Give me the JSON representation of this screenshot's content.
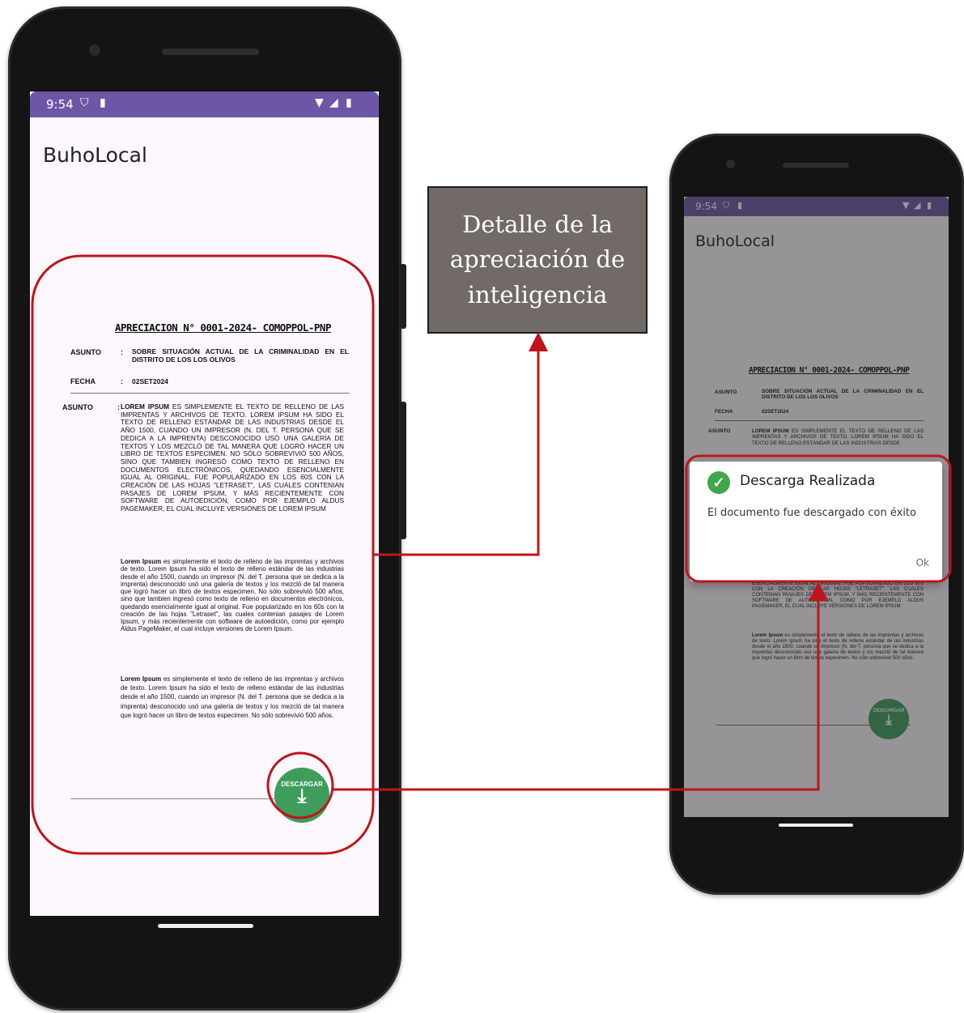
{
  "phone_left": {
    "status": {
      "time": "9:54",
      "left_icons": [
        "shield-icon",
        "sim-icon"
      ],
      "right_icons": [
        "wifi-icon",
        "signal-icon",
        "battery-icon"
      ]
    },
    "app_title": "BuhoLocal",
    "document": {
      "title": "APRECIACION N° 0001-2024- COMOPPOL-PNP",
      "asunto_label": "ASUNTO",
      "asunto_colon": ":",
      "asunto_value": "SOBRE SITUACIÓN ACTUAL DE LA CRIMINALIDAD EN EL DISTRITO DE LOS LOS OLIVOS",
      "fecha_label": "FECHA",
      "fecha_colon": ":",
      "fecha_value": "02SET2024",
      "body_label": "ASUNTO",
      "body_colon": ":",
      "body_lead": "LOREM IPSUM",
      "body_text": " ES SIMPLEMENTE EL TEXTO DE RELLENO DE LAS IMPRENTAS Y ARCHIVOS DE TEXTO. LOREM IPSUM HA SIDO EL TEXTO DE RELLENO ESTÁNDAR DE LAS INDUSTRIAS DESDE EL AÑO 1500, CUANDO UN IMPRESOR (N. DEL T. PERSONA QUE SE DEDICA A LA IMPRENTA) DESCONOCIDO USÓ UNA GALERÍA DE TEXTOS Y LOS MEZCLÓ DE TAL MANERA QUE LOGRÓ HACER UN LIBRO DE TEXTOS ESPECIMEN. NO SÓLO SOBREVIVIÓ 500 AÑOS, SINO QUE TAMBIEN INGRESÓ COMO TEXTO DE RELLENO EN DOCUMENTOS ELECTRÓNICOS, QUEDANDO ESENCIALMENTE IGUAL AL ORIGINAL. FUE POPULARIZADO EN LOS 60S CON LA CREACIÓN DE LAS HOJAS \"LETRASET\", LAS CUALES CONTENIAN PASAJES DE LOREM IPSUM, Y MÁS RECIENTEMENTE CON SOFTWARE DE AUTOEDICIÓN, COMO POR EJEMPLO ALDUS PAGEMAKER, EL CUAL INCLUYE VERSIONES DE LOREM IPSUM",
      "para2_lead": "Lorem Ipsum",
      "para2_text": " es simplemente el texto de relleno de las imprentas y archivos de texto. Lorem Ipsum ha sido el texto de relleno estándar de las industrias desde el año 1500, cuando un impresor (N. del T. persona que se dedica a la imprenta) desconocido usó una galería de textos y los mezcló de tal manera que logró hacer un libro de textos especimen. No sólo sobrevivió 500 años, sino que tambien ingresó como texto de relleno en documentos electrónicos, quedando esencialmente igual al original. Fue popularizado en los 60s con la creación de las hojas \"Letraset\", las cuales contenian pasajes de Lorem Ipsum, y más recientemente con software de autoedición, como por ejemplo Aldus PageMaker, el cual incluye versiones de Lorem Ipsum.",
      "para3_lead": "Lorem Ipsum",
      "para3_text": " es simplemente el texto de relleno de las imprentas y archivos de texto. Lorem Ipsum ha sido el texto de relleno estándar de las industrias desde el año 1500, cuando un impresor (N. del T. persona que se dedica a la imprenta) desconocido usó una galería de textos y los mezcló de tal manera que logró hacer un libro de textos especimen. No sólo sobrevivió 500 años."
    },
    "fab_label": "DESCARGAR",
    "fab_icon": "download-icon"
  },
  "annotation": {
    "text": "Detalle de la apreciación de inteligencia"
  },
  "phone_right": {
    "status": {
      "time": "9:54"
    },
    "app_title": "BuhoLocal",
    "document": {
      "title": "APRECIACION N° 0001-2024- COMOPPOL-PNP",
      "asunto_label": "ASUNTO",
      "asunto_value": "SOBRE SITUACIÓN ACTUAL DE LA CRIMINALIDAD EN EL DISTRITO DE LOS LOS OLIVOS",
      "fecha_label": "FECHA",
      "fecha_value": "02SET2024",
      "body_label": "ASUNTO",
      "body_lead": "LOREM IPSUM",
      "body_text": " ES SIMPLEMENTE EL TEXTO DE RELLENO DE LAS IMPRENTAS Y ARCHIVOS DE TEXTO. LOREM IPSUM HA SIDO EL TEXTO DE RELLENO ESTÁNDAR DE LAS INDUSTRIAS DESDE",
      "lower_text": "ESENCIALMENTE IGUAL AL ORIGINAL. FUE POPULARIZADO EN LOS 60S CON LA CREACIÓN DE LAS HOJAS \"LETRASET\", LAS CUALES CONTENIAN PASAJES DE LOREM IPSUM, Y MÁS RECIENTEMENTE CON SOFTWARE DE AUTOEDICIÓN, COMO POR EJEMPLO ALDUS PAGEMAKER, EL CUAL INCLUYE VERSIONES DE LOREM IPSUM",
      "para2_lead": "Lorem Ipsum",
      "para2_text": " es simplemente el texto de relleno de las imprentas y archivos de texto. Lorem Ipsum ha sido el texto de relleno estándar de las industrias desde el año 1500, cuando un impresor (N. del T. persona que se dedica a la imprenta) desconocido usó una galería de textos y los mezcló de tal manera que logró hacer un libro de textos especimen. No sólo sobrevivió 500 años."
    },
    "dialog": {
      "title": "Descarga Realizada",
      "message": "El documento fue descargado con éxito",
      "ok": "Ok",
      "icon": "check-circle-icon"
    },
    "fab_label": "DESCARGAR"
  },
  "colors": {
    "status_bar": "#6e56a6",
    "highlight": "#c0141c",
    "fab": "#3e9d5b",
    "annotation_box": "#726a66"
  }
}
